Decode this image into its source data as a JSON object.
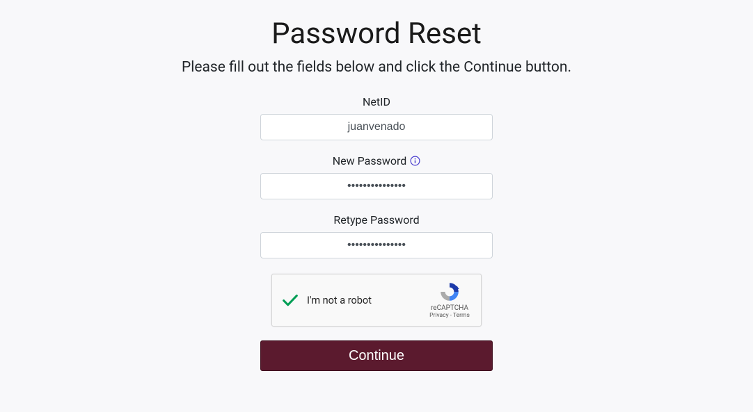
{
  "page": {
    "title": "Password Reset",
    "instructions": "Please fill out the fields below and click the Continue button."
  },
  "form": {
    "netid": {
      "label": "NetID",
      "value": "juanvenado"
    },
    "newPassword": {
      "label": "New Password",
      "value": "•••••••••••••••"
    },
    "retypePassword": {
      "label": "Retype Password",
      "value": "•••••••••••••••"
    },
    "continueLabel": "Continue"
  },
  "captcha": {
    "label": "I'm not a robot",
    "brand": "reCAPTCHA",
    "privacy": "Privacy",
    "terms": "Terms",
    "checked": true
  }
}
